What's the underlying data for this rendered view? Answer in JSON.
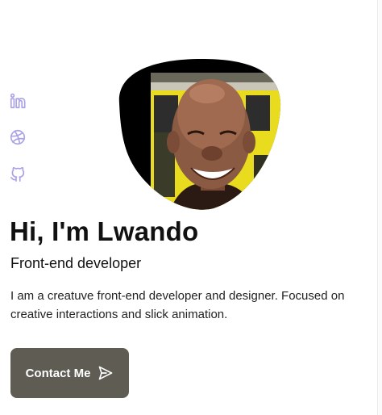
{
  "social": [
    {
      "name": "linkedin",
      "icon": "linkedin-icon"
    },
    {
      "name": "dribbble",
      "icon": "dribbble-icon"
    },
    {
      "name": "github",
      "icon": "github-icon"
    }
  ],
  "hero": {
    "title": "Hi, I'm Lwando",
    "subtitle": "Front-end developer",
    "description": "I am a creatuve front-end developer and designer. Focused on creative interactions and slick animation.",
    "contact_label": "Contact Me",
    "contact_icon": "send-icon"
  },
  "colors": {
    "accent_icons": "#a9a3e6",
    "button_bg": "#5f5c54",
    "button_text": "#ffffff"
  }
}
